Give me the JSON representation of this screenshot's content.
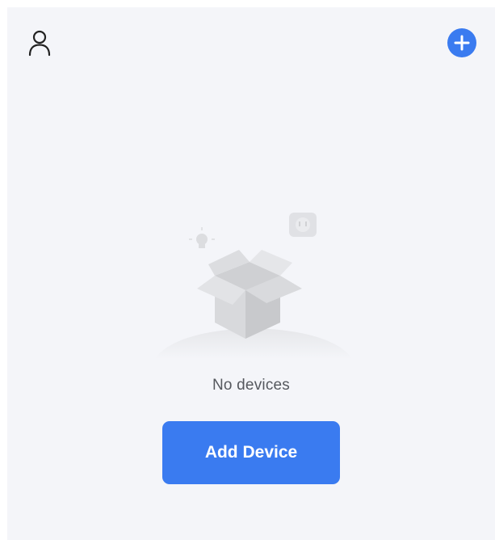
{
  "header": {
    "user_icon": "user-icon",
    "add_icon": "plus-icon"
  },
  "empty_state": {
    "illustration": "empty-box-illustration",
    "message": "No devices"
  },
  "actions": {
    "add_device_label": "Add Device"
  },
  "colors": {
    "accent": "#3a7bf0",
    "background": "#f4f5f9",
    "text_secondary": "#55585e"
  }
}
